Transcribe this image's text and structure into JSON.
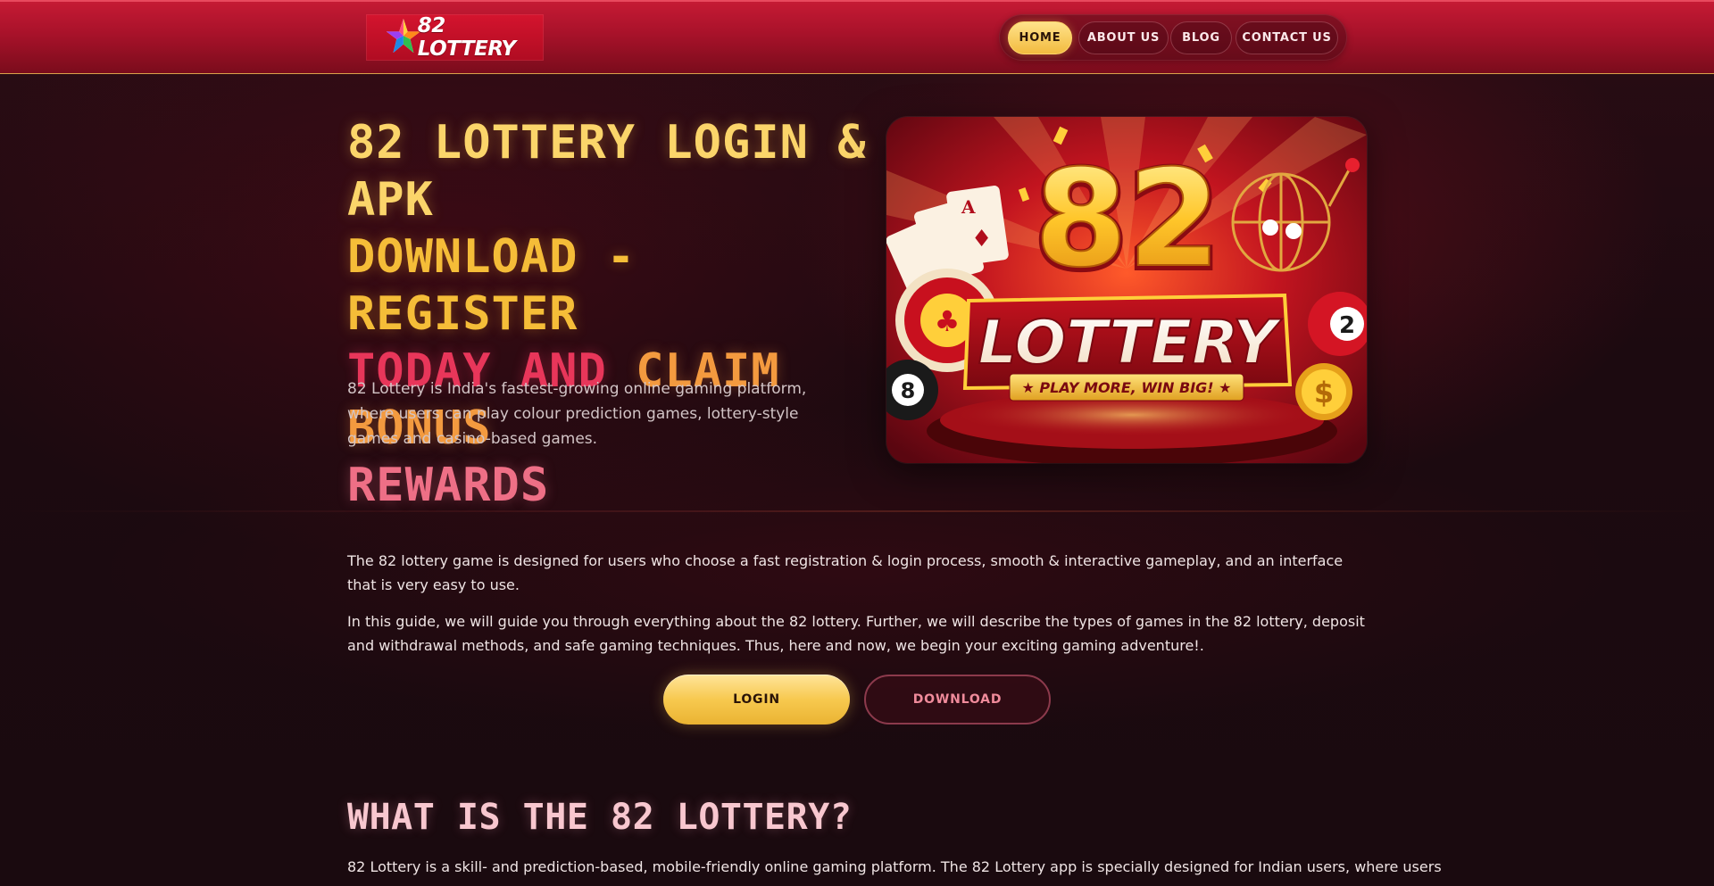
{
  "header": {
    "logo_text": "82 LOTTERY",
    "nav": {
      "home": "HOME",
      "about": "ABOUT US",
      "blog": "BLOG",
      "contact": "CONTACT US"
    },
    "active_item": "HOME"
  },
  "hero": {
    "title_parts": {
      "l1": "82 Lottery Login & APK",
      "l2": "Download - Register",
      "l3a": "Today and ",
      "l3b": "Claim Bonus",
      "l4": "Rewards"
    },
    "description": "82 Lottery is India's fastest-growing online gaming platform, where users can play colour prediction games, lottery-style games and casino-based games.",
    "banner": {
      "big_number": "82",
      "word": "LOTTERY",
      "slogan": "★ PLAY MORE, WIN BIG! ★",
      "ball_left": "8",
      "ball_right": "2",
      "coin_symbol": "$"
    }
  },
  "intro": {
    "p1": "The 82 lottery game is designed for users who choose a fast registration & login process, smooth & interactive gameplay, and an interface that is very easy to use.",
    "p2": "In this guide, we will guide you through everything about the 82 lottery. Further, we will describe the types of games in the 82 lottery, deposit and withdrawal methods, and safe gaming techniques. Thus, here and now, we begin your exciting gaming adventure!.",
    "login_label": "LOGIN",
    "download_label": "DOWNLOAD"
  },
  "what_is": {
    "heading": "What is the 82 Lottery?",
    "text": "82 Lottery is a skill- and prediction-based, mobile-friendly online gaming platform. The 82 Lottery app is specially designed for Indian users, where users"
  },
  "colors": {
    "header_red": "#b5142c",
    "gold": "#f5bd38",
    "pink": "#ee6f86",
    "background": "#1a0a0e"
  }
}
